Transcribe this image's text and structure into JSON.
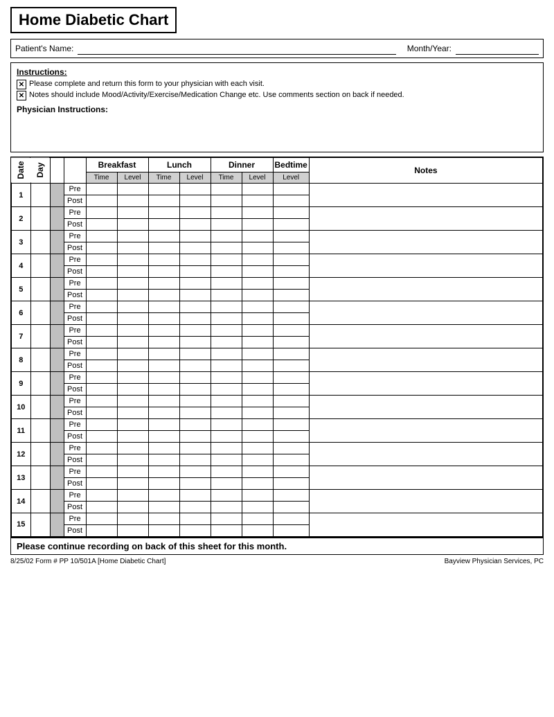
{
  "title": "Home Diabetic Chart",
  "patient_label": "Patient's Name:",
  "month_label": "Month/Year:",
  "instructions": {
    "title": "Instructions:",
    "lines": [
      "Please complete and return this form to your physician with each visit.",
      "Notes should include Mood/Activity/Exercise/Medication Change etc.  Use comments section on back if needed."
    ],
    "physician_title": "Physician Instructions:"
  },
  "table_headers": {
    "date": "Date",
    "day": "Day",
    "breakfast": "Breakfast",
    "lunch": "Lunch",
    "dinner": "Dinner",
    "bedtime": "Bedtime",
    "notes": "Notes",
    "time": "Time",
    "level": "Level"
  },
  "pre_post": {
    "pre": "Pre",
    "post": "Post"
  },
  "days": [
    1,
    2,
    3,
    4,
    5,
    6,
    7,
    8,
    9,
    10,
    11,
    12,
    13,
    14,
    15
  ],
  "footer_continue": "Please continue recording on back of this sheet for this month.",
  "bottom_left": "8/25/02  Form #  PP 10/501A   [Home Diabetic Chart]",
  "bottom_right": "Bayview Physician Services, PC"
}
